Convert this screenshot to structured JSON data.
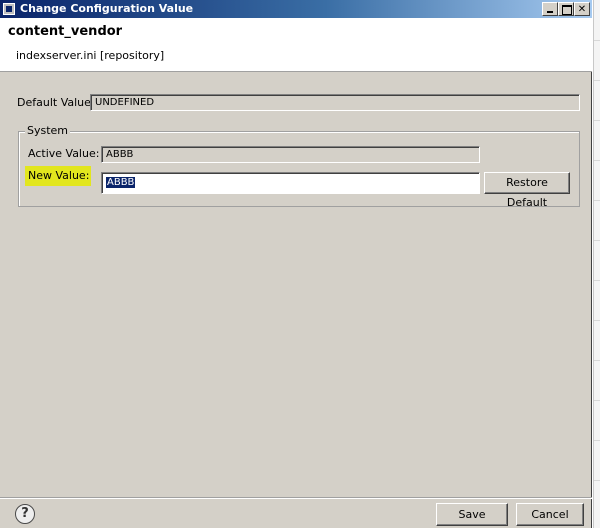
{
  "window": {
    "title": "Change Configuration Value"
  },
  "header": {
    "title": "content_vendor",
    "subtitle": "indexserver.ini [repository]"
  },
  "default_value": {
    "label": "Default Value:",
    "value": "UNDEFINED"
  },
  "group": {
    "legend": "System",
    "active_value_label": "Active Value:",
    "active_value": "ABBB",
    "new_value_label": "New Value:",
    "new_value": "ABBB",
    "restore_label": "Restore Default"
  },
  "footer": {
    "help_glyph": "?",
    "save_label": "Save",
    "cancel_label": "Cancel"
  },
  "colors": {
    "title_bar": "#0a246a",
    "dialog_bg": "#d4d0c8",
    "highlight": "#e2e61e",
    "selection": "#0a246a"
  },
  "icons": {
    "window": "app-icon",
    "minimize": "minimize-icon",
    "maximize": "maximize-icon",
    "close": "close-icon",
    "help": "help-icon"
  }
}
